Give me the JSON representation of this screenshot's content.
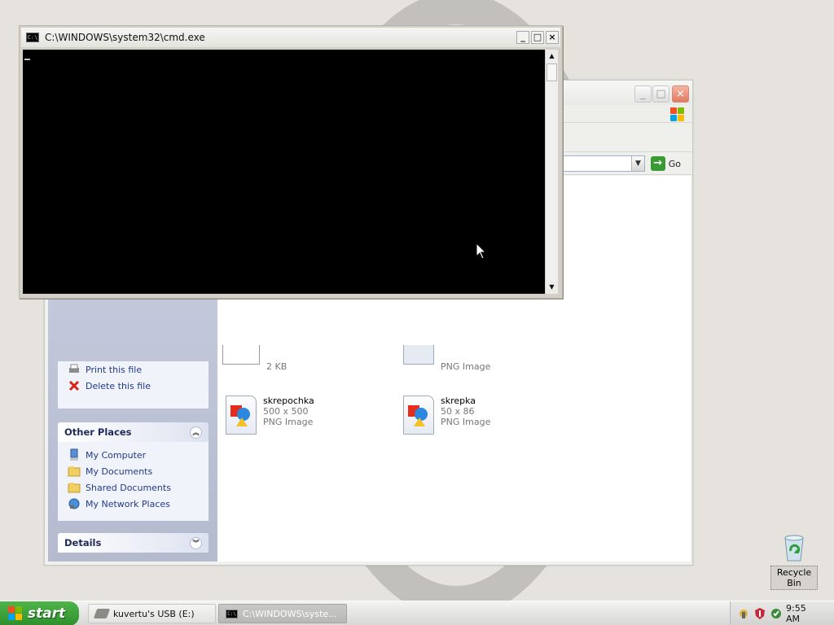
{
  "cmd_window": {
    "title": "C:\\WINDOWS\\system32\\cmd.exe",
    "minimize": "_",
    "maximize": "□",
    "close": "×",
    "system_icon_text": "C:\\"
  },
  "explorer": {
    "address_value": "",
    "go_label": "Go",
    "file_tasks": {
      "items": [
        "Print this file",
        "Delete this file"
      ]
    },
    "other_places": {
      "title": "Other Places",
      "items": [
        "My Computer",
        "My Documents",
        "Shared Documents",
        "My Network Places"
      ]
    },
    "details": {
      "title": "Details"
    },
    "files": [
      {
        "name": "",
        "sub1": "2 KB",
        "sub2": ""
      },
      {
        "name": "",
        "sub1": "PNG Image",
        "sub2": ""
      },
      {
        "name": "skrepochka",
        "sub1": "500 x 500",
        "sub2": "PNG Image"
      },
      {
        "name": "skrepka",
        "sub1": "50 x 86",
        "sub2": "PNG Image"
      }
    ]
  },
  "desktop": {
    "recycle_bin_label": "Recycle Bin"
  },
  "taskbar": {
    "start_label": "start",
    "tasks": [
      {
        "label": "kuvertu's USB (E:)",
        "active": false
      },
      {
        "label": "C:\\WINDOWS\\syste...",
        "active": true
      }
    ],
    "clock": "9:55 AM"
  },
  "colors": {
    "xp_red": "#f25022",
    "xp_green": "#7fba00",
    "xp_blue": "#00a4ef",
    "xp_yellow": "#ffb900",
    "start_green": "#3a9b35",
    "console_bg": "#000000",
    "link_blue": "#213a8a"
  }
}
